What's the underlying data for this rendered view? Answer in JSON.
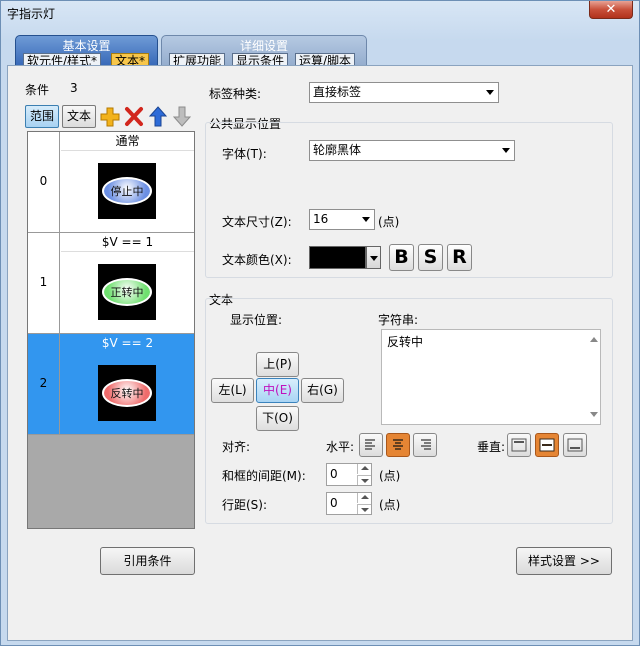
{
  "window": {
    "title": "字指示灯",
    "close_glyph": "✕"
  },
  "tabs": {
    "basic": {
      "title": "基本设置",
      "subtabs": [
        "软元件/样式*",
        "文本*"
      ],
      "active": "文本*"
    },
    "detail": {
      "title": "详细设置",
      "subtabs": [
        "扩展功能",
        "显示条件",
        "运算/脚本"
      ]
    }
  },
  "conditions": {
    "label": "条件",
    "count": "3",
    "toolbar": {
      "range_label": "范围",
      "text_label": "文本"
    },
    "rows": [
      {
        "index": "0",
        "condition": "通常",
        "lamp_text": "停止中",
        "lamp_color": "#6b8fe3"
      },
      {
        "index": "1",
        "condition": "$V  ==  1",
        "lamp_text": "正转中",
        "lamp_color": "#6fe06f"
      },
      {
        "index": "2",
        "condition": "$V  ==  2",
        "lamp_text": "反转中",
        "lamp_color": "#ef6b6b"
      }
    ]
  },
  "label_type": {
    "label": "标签种类:",
    "value": "直接标签"
  },
  "common_display": {
    "title": "公共显示位置",
    "font": {
      "label": "字体(T):",
      "value": "轮廓黑体"
    },
    "text_size": {
      "label": "文本尺寸(Z):",
      "value": "16",
      "unit": "(点)"
    },
    "text_color": {
      "label": "文本颜色(X):",
      "value": "#000000"
    },
    "style_buttons": [
      "B",
      "S",
      "R"
    ]
  },
  "text_section": {
    "title": "文本",
    "display_position_label": "显示位置:",
    "string_label": "字符串:",
    "string_value": "反转中",
    "positions": {
      "up": "上(P)",
      "left": "左(L)",
      "center": "中(E)",
      "right": "右(G)",
      "down": "下(O)"
    },
    "align_label": "对齐:",
    "horizontal_label": "水平:",
    "vertical_label": "垂直:",
    "margin": {
      "label": "和框的间距(M):",
      "value": "0",
      "unit": "(点)"
    },
    "line_spacing": {
      "label": "行距(S):",
      "value": "0",
      "unit": "(点)"
    }
  },
  "footer": {
    "ref_condition": "引用条件",
    "style_settings": "样式设置 >>"
  }
}
